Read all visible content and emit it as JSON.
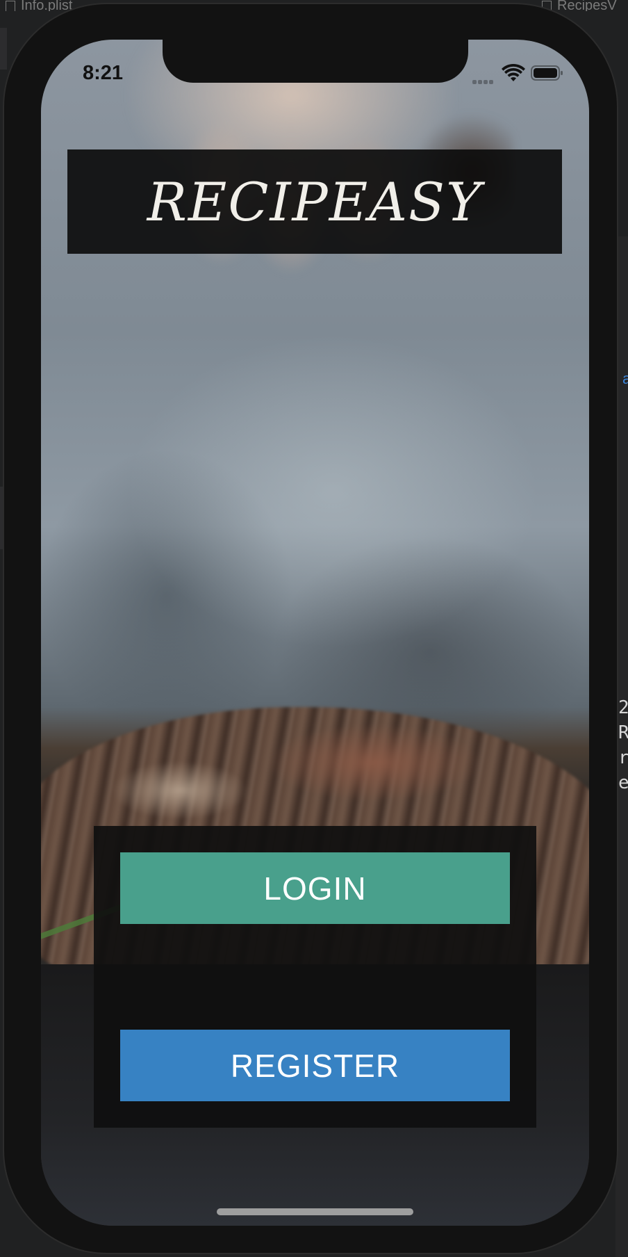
{
  "background": {
    "left_tab": "Info.plist",
    "right_tab": "RecipesV",
    "side_link_text": "a",
    "code_lines": [
      "2",
      "R",
      "r",
      "e"
    ]
  },
  "status_bar": {
    "time": "8:21",
    "icons": [
      "signal-icon",
      "wifi-icon",
      "battery-icon"
    ]
  },
  "app": {
    "title": "RECIPEASY",
    "login_label": "LOGIN",
    "register_label": "REGISTER"
  },
  "colors": {
    "login": "#49a08c",
    "register": "#3782c3",
    "title_box": "#0a0a0a"
  }
}
